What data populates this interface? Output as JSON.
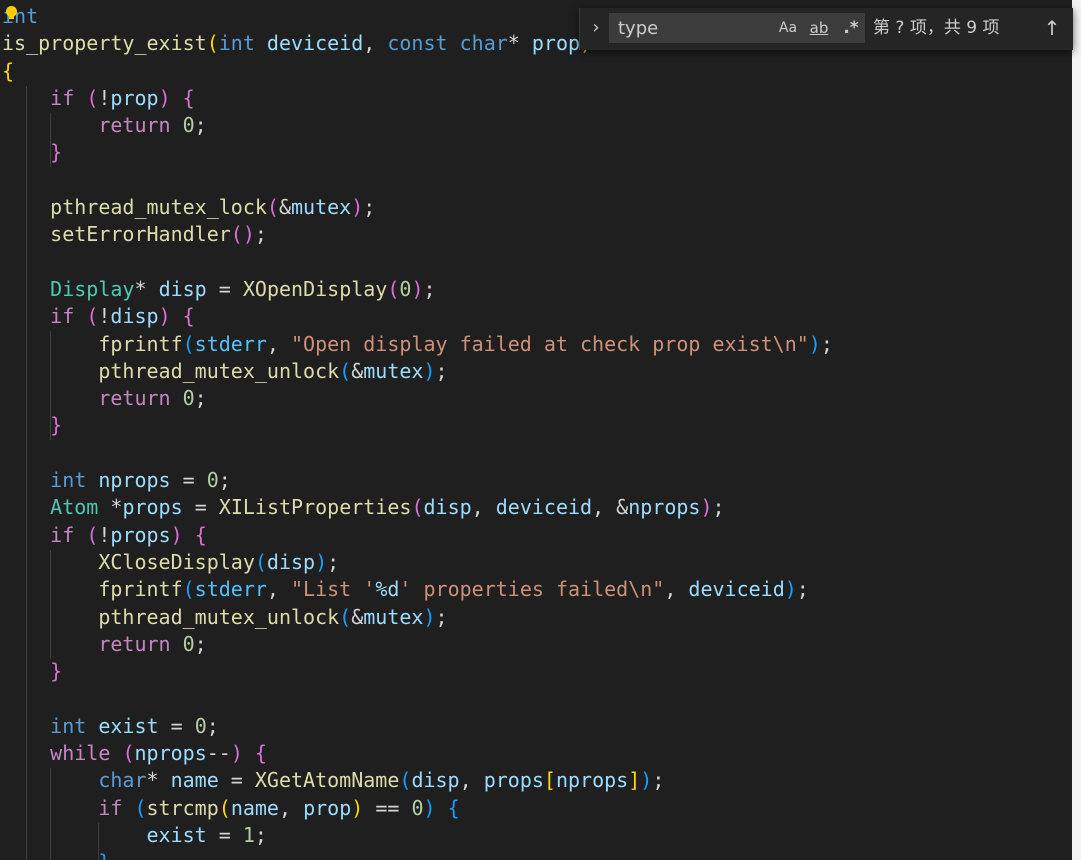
{
  "editor": {
    "lines": [
      [
        {
          "t": "int",
          "c": "kw"
        }
      ],
      [
        {
          "t": "is_property_exist",
          "c": "fn"
        },
        {
          "t": "(",
          "c": "b1"
        },
        {
          "t": "int",
          "c": "kw"
        },
        {
          "t": " "
        },
        {
          "t": "deviceid",
          "c": "var"
        },
        {
          "t": ", "
        },
        {
          "t": "const",
          "c": "kw"
        },
        {
          "t": " "
        },
        {
          "t": "char",
          "c": "kw"
        },
        {
          "t": "* "
        },
        {
          "t": "prop",
          "c": "var"
        },
        {
          "t": ")",
          "c": "b1"
        }
      ],
      [
        {
          "t": "{",
          "c": "b1"
        }
      ],
      [
        {
          "t": "    "
        },
        {
          "t": "if",
          "c": "ctl"
        },
        {
          "t": " "
        },
        {
          "t": "(",
          "c": "b2"
        },
        {
          "t": "!"
        },
        {
          "t": "prop",
          "c": "var"
        },
        {
          "t": ")",
          "c": "b2"
        },
        {
          "t": " "
        },
        {
          "t": "{",
          "c": "b2"
        }
      ],
      [
        {
          "t": "        "
        },
        {
          "t": "return",
          "c": "ctl"
        },
        {
          "t": " "
        },
        {
          "t": "0",
          "c": "num"
        },
        {
          "t": ";"
        }
      ],
      [
        {
          "t": "    "
        },
        {
          "t": "}",
          "c": "b2"
        }
      ],
      [
        {
          "t": ""
        }
      ],
      [
        {
          "t": "    "
        },
        {
          "t": "pthread_mutex_lock",
          "c": "fn"
        },
        {
          "t": "(",
          "c": "b2"
        },
        {
          "t": "&"
        },
        {
          "t": "mutex",
          "c": "var"
        },
        {
          "t": ")",
          "c": "b2"
        },
        {
          "t": ";"
        }
      ],
      [
        {
          "t": "    "
        },
        {
          "t": "setErrorHandler",
          "c": "fn"
        },
        {
          "t": "()",
          "c": "b2"
        },
        {
          "t": ";"
        }
      ],
      [
        {
          "t": ""
        }
      ],
      [
        {
          "t": "    "
        },
        {
          "t": "Display",
          "c": "ty"
        },
        {
          "t": "* "
        },
        {
          "t": "disp",
          "c": "var"
        },
        {
          "t": " = "
        },
        {
          "t": "XOpenDisplay",
          "c": "fn"
        },
        {
          "t": "(",
          "c": "b2"
        },
        {
          "t": "0",
          "c": "num"
        },
        {
          "t": ")",
          "c": "b2"
        },
        {
          "t": ";"
        }
      ],
      [
        {
          "t": "    "
        },
        {
          "t": "if",
          "c": "ctl"
        },
        {
          "t": " "
        },
        {
          "t": "(",
          "c": "b2"
        },
        {
          "t": "!"
        },
        {
          "t": "disp",
          "c": "var"
        },
        {
          "t": ")",
          "c": "b2"
        },
        {
          "t": " "
        },
        {
          "t": "{",
          "c": "b2"
        }
      ],
      [
        {
          "t": "        "
        },
        {
          "t": "fprintf",
          "c": "fn"
        },
        {
          "t": "(",
          "c": "b3"
        },
        {
          "t": "stderr",
          "c": "glob"
        },
        {
          "t": ", "
        },
        {
          "t": "\"Open display failed at check prop exist\\n\"",
          "c": "str"
        },
        {
          "t": ")",
          "c": "b3"
        },
        {
          "t": ";"
        }
      ],
      [
        {
          "t": "        "
        },
        {
          "t": "pthread_mutex_unlock",
          "c": "fn"
        },
        {
          "t": "(",
          "c": "b3"
        },
        {
          "t": "&"
        },
        {
          "t": "mutex",
          "c": "var"
        },
        {
          "t": ")",
          "c": "b3"
        },
        {
          "t": ";"
        }
      ],
      [
        {
          "t": "        "
        },
        {
          "t": "return",
          "c": "ctl"
        },
        {
          "t": " "
        },
        {
          "t": "0",
          "c": "num"
        },
        {
          "t": ";"
        }
      ],
      [
        {
          "t": "    "
        },
        {
          "t": "}",
          "c": "b2"
        }
      ],
      [
        {
          "t": ""
        }
      ],
      [
        {
          "t": "    "
        },
        {
          "t": "int",
          "c": "kw"
        },
        {
          "t": " "
        },
        {
          "t": "nprops",
          "c": "var"
        },
        {
          "t": " = "
        },
        {
          "t": "0",
          "c": "num"
        },
        {
          "t": ";"
        }
      ],
      [
        {
          "t": "    "
        },
        {
          "t": "Atom",
          "c": "ty"
        },
        {
          "t": " *"
        },
        {
          "t": "props",
          "c": "var"
        },
        {
          "t": " = "
        },
        {
          "t": "XIListProperties",
          "c": "fn"
        },
        {
          "t": "(",
          "c": "b2"
        },
        {
          "t": "disp",
          "c": "var"
        },
        {
          "t": ", "
        },
        {
          "t": "deviceid",
          "c": "var"
        },
        {
          "t": ", &"
        },
        {
          "t": "nprops",
          "c": "var"
        },
        {
          "t": ")",
          "c": "b2"
        },
        {
          "t": ";"
        }
      ],
      [
        {
          "t": "    "
        },
        {
          "t": "if",
          "c": "ctl"
        },
        {
          "t": " "
        },
        {
          "t": "(",
          "c": "b2"
        },
        {
          "t": "!"
        },
        {
          "t": "props",
          "c": "var"
        },
        {
          "t": ")",
          "c": "b2"
        },
        {
          "t": " "
        },
        {
          "t": "{",
          "c": "b2"
        }
      ],
      [
        {
          "t": "        "
        },
        {
          "t": "XCloseDisplay",
          "c": "fn"
        },
        {
          "t": "(",
          "c": "b3"
        },
        {
          "t": "disp",
          "c": "var"
        },
        {
          "t": ")",
          "c": "b3"
        },
        {
          "t": ";"
        }
      ],
      [
        {
          "t": "        "
        },
        {
          "t": "fprintf",
          "c": "fn"
        },
        {
          "t": "(",
          "c": "b3"
        },
        {
          "t": "stderr",
          "c": "glob"
        },
        {
          "t": ", "
        },
        {
          "t": "\"List '",
          "c": "str"
        },
        {
          "t": "%d",
          "c": "var"
        },
        {
          "t": "' properties failed\\n\"",
          "c": "str"
        },
        {
          "t": ", "
        },
        {
          "t": "deviceid",
          "c": "var"
        },
        {
          "t": ")",
          "c": "b3"
        },
        {
          "t": ";"
        }
      ],
      [
        {
          "t": "        "
        },
        {
          "t": "pthread_mutex_unlock",
          "c": "fn"
        },
        {
          "t": "(",
          "c": "b3"
        },
        {
          "t": "&"
        },
        {
          "t": "mutex",
          "c": "var"
        },
        {
          "t": ")",
          "c": "b3"
        },
        {
          "t": ";"
        }
      ],
      [
        {
          "t": "        "
        },
        {
          "t": "return",
          "c": "ctl"
        },
        {
          "t": " "
        },
        {
          "t": "0",
          "c": "num"
        },
        {
          "t": ";"
        }
      ],
      [
        {
          "t": "    "
        },
        {
          "t": "}",
          "c": "b2"
        }
      ],
      [
        {
          "t": ""
        }
      ],
      [
        {
          "t": "    "
        },
        {
          "t": "int",
          "c": "kw"
        },
        {
          "t": " "
        },
        {
          "t": "exist",
          "c": "var"
        },
        {
          "t": " = "
        },
        {
          "t": "0",
          "c": "num"
        },
        {
          "t": ";"
        }
      ],
      [
        {
          "t": "    "
        },
        {
          "t": "while",
          "c": "ctl"
        },
        {
          "t": " "
        },
        {
          "t": "(",
          "c": "b2"
        },
        {
          "t": "nprops",
          "c": "var"
        },
        {
          "t": "--"
        },
        {
          "t": ")",
          "c": "b2"
        },
        {
          "t": " "
        },
        {
          "t": "{",
          "c": "b2"
        }
      ],
      [
        {
          "t": "        "
        },
        {
          "t": "char",
          "c": "kw"
        },
        {
          "t": "* "
        },
        {
          "t": "name",
          "c": "var"
        },
        {
          "t": " = "
        },
        {
          "t": "XGetAtomName",
          "c": "fn"
        },
        {
          "t": "(",
          "c": "b3"
        },
        {
          "t": "disp",
          "c": "var"
        },
        {
          "t": ", "
        },
        {
          "t": "props",
          "c": "var"
        },
        {
          "t": "[",
          "c": "b1"
        },
        {
          "t": "nprops",
          "c": "var"
        },
        {
          "t": "]",
          "c": "b1"
        },
        {
          "t": ")",
          "c": "b3"
        },
        {
          "t": ";"
        }
      ],
      [
        {
          "t": "        "
        },
        {
          "t": "if",
          "c": "ctl"
        },
        {
          "t": " "
        },
        {
          "t": "(",
          "c": "b3"
        },
        {
          "t": "strcmp",
          "c": "fn"
        },
        {
          "t": "(",
          "c": "b1"
        },
        {
          "t": "name",
          "c": "var"
        },
        {
          "t": ", "
        },
        {
          "t": "prop",
          "c": "var"
        },
        {
          "t": ")",
          "c": "b1"
        },
        {
          "t": " == "
        },
        {
          "t": "0",
          "c": "num"
        },
        {
          "t": ")",
          "c": "b3"
        },
        {
          "t": " "
        },
        {
          "t": "{",
          "c": "b3"
        }
      ],
      [
        {
          "t": "            "
        },
        {
          "t": "exist",
          "c": "var"
        },
        {
          "t": " = "
        },
        {
          "t": "1",
          "c": "num"
        },
        {
          "t": ";"
        }
      ],
      [
        {
          "t": "        "
        },
        {
          "t": "}",
          "c": "b3"
        }
      ]
    ]
  },
  "find": {
    "toggle_icon": "chevron-right-icon",
    "toggle_glyph": "›",
    "value": "type",
    "match_case_label": "Aa",
    "whole_word_label": "ab",
    "regex_label": ".*",
    "match_count": "第 ? 项，共 9 项",
    "prev_icon": "arrow-up-icon",
    "prev_glyph": "↑"
  },
  "colors": {
    "background": "#1f1f1f",
    "keyword": "#569cd6",
    "control": "#c586c0",
    "function": "#dcdcaa",
    "type": "#4ec9b0",
    "variable": "#9cdcfe",
    "string": "#ce9178",
    "number": "#b5cea8"
  }
}
